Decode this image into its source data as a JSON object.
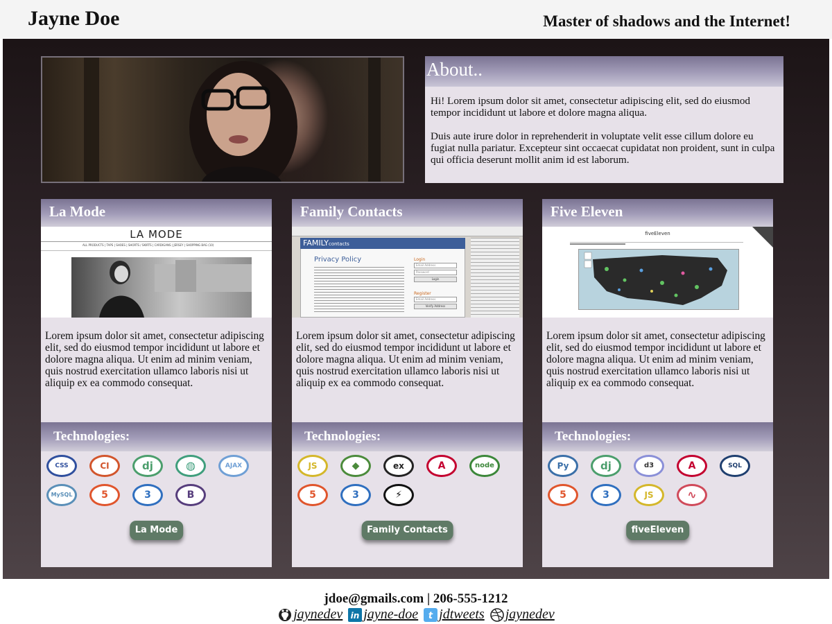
{
  "header": {
    "name": "Jayne Doe",
    "tagline": "Master of shadows and the Internet!"
  },
  "about": {
    "title": "About..",
    "paragraphs": [
      "Hi! Lorem ipsum dolor sit amet, consectetur adipiscing elit, sed do eiusmod tempor incididunt ut labore et dolore magna aliqua.",
      "Duis aute irure dolor in reprehenderit in voluptate velit esse cillum dolore eu fugiat nulla pariatur. Excepteur sint occaecat cupidatat non proident, sunt in culpa qui officia deserunt mollit anim id est laborum."
    ]
  },
  "projects": [
    {
      "title": "La Mode",
      "description": "Lorem ipsum dolor sit amet, consectetur adipiscing elit, sed do eiusmod tempor incididunt ut labore et dolore magna aliqua. Ut enim ad minim veniam, quis nostrud exercitation ullamco laboris nisi ut aliquip ex ea commodo consequat.",
      "technologies_label": "Technologies:",
      "button_label": "La Mode",
      "screenshot": {
        "brand": "LA MODE",
        "nav": "ALL PRODUCTS | TAPS | SHOES | SHORTS / SKIRTS | CARDIGANS | JERSEY | SHOPPING BAG (10)"
      },
      "icons": [
        {
          "name": "css-file-icon",
          "text": "CSS",
          "color": "#2f4f9e"
        },
        {
          "name": "codeigniter-icon",
          "text": "CI",
          "color": "#d2552c"
        },
        {
          "name": "django-icon",
          "text": "dj",
          "color": "#4b9e6c"
        },
        {
          "name": "sphere-icon",
          "text": "◍",
          "color": "#3f9e7c"
        },
        {
          "name": "ajax-icon",
          "text": "AJAX",
          "color": "#6f9fd5"
        },
        {
          "name": "mysql-icon",
          "text": "MySQL",
          "color": "#5a8fb8"
        },
        {
          "name": "html5-icon",
          "text": "5",
          "color": "#e0552c"
        },
        {
          "name": "css3-icon",
          "text": "3",
          "color": "#2f6fbf"
        },
        {
          "name": "bootstrap-icon",
          "text": "B",
          "color": "#563d7c"
        }
      ]
    },
    {
      "title": "Family Contacts",
      "description": "Lorem ipsum dolor sit amet, consectetur adipiscing elit, sed do eiusmod tempor incididunt ut labore et dolore magna aliqua. Ut enim ad minim veniam, quis nostrud exercitation ullamco laboris nisi ut aliquip ex ea commodo consequat.",
      "technologies_label": "Technologies:",
      "button_label": "Family Contacts",
      "screenshot": {
        "brand": "FAMILY",
        "brand_suffix": "contacts",
        "heading": "Privacy Policy",
        "login": "Login",
        "register": "Register",
        "email_placeholder": "Email Address",
        "password_placeholder": "Password",
        "login_button": "Login",
        "verify_button": "Verify Address"
      },
      "icons": [
        {
          "name": "javascript-icon",
          "text": "JS",
          "color": "#d4b72a"
        },
        {
          "name": "mongodb-icon",
          "text": "◆",
          "color": "#4b8b3b"
        },
        {
          "name": "express-icon",
          "text": "ex",
          "color": "#222222"
        },
        {
          "name": "angular-icon",
          "text": "A",
          "color": "#c3002f"
        },
        {
          "name": "nodejs-icon",
          "text": "node",
          "color": "#3c873a"
        },
        {
          "name": "html5-icon",
          "text": "5",
          "color": "#e0552c"
        },
        {
          "name": "css3-icon",
          "text": "3",
          "color": "#2f6fbf"
        },
        {
          "name": "lightning-icon",
          "text": "⚡",
          "color": "#111111"
        }
      ]
    },
    {
      "title": "Five Eleven",
      "description": "Lorem ipsum dolor sit amet, consectetur adipiscing elit, sed do eiusmod tempor incididunt ut labore et dolore magna aliqua. Ut enim ad minim veniam, quis nostrud exercitation ullamco laboris nisi ut aliquip ex ea commodo consequat.",
      "technologies_label": "Technologies:",
      "button_label": "fiveEleven",
      "screenshot": {
        "brand": "fiveEleven"
      },
      "icons": [
        {
          "name": "python-icon",
          "text": "Py",
          "color": "#3a6fa8"
        },
        {
          "name": "django-icon",
          "text": "dj",
          "color": "#4b9e6c"
        },
        {
          "name": "d3js-icon",
          "text": "d3",
          "color": "#8a8fd8"
        },
        {
          "name": "angular-icon",
          "text": "A",
          "color": "#c3002f"
        },
        {
          "name": "sqlite-icon",
          "text": "SQL",
          "color": "#1f3f6f"
        },
        {
          "name": "html5-icon",
          "text": "5",
          "color": "#e0552c"
        },
        {
          "name": "css3-icon",
          "text": "3",
          "color": "#2f6fbf"
        },
        {
          "name": "javascript-icon",
          "text": "JS",
          "color": "#d4b72a"
        },
        {
          "name": "maps-api-icon",
          "text": "∿",
          "color": "#d04a5a"
        }
      ]
    }
  ],
  "footer": {
    "contact": "jdoe@gmails.com | 206-555-1212",
    "links": [
      {
        "name": "github-link",
        "icon": "github-icon",
        "label": "jaynedev"
      },
      {
        "name": "linkedin-link",
        "icon": "linkedin-icon",
        "label": "jayne-doe"
      },
      {
        "name": "twitter-link",
        "icon": "twitter-icon",
        "label": "jdtweets"
      },
      {
        "name": "dribbble-link",
        "icon": "dribbble-icon",
        "label": "jaynedev"
      }
    ]
  },
  "colors": {
    "section_header": "#a39db9",
    "card_bg": "#e7e1e9",
    "button_bg": "#5f7a66",
    "main_bg": "#2f2529"
  }
}
